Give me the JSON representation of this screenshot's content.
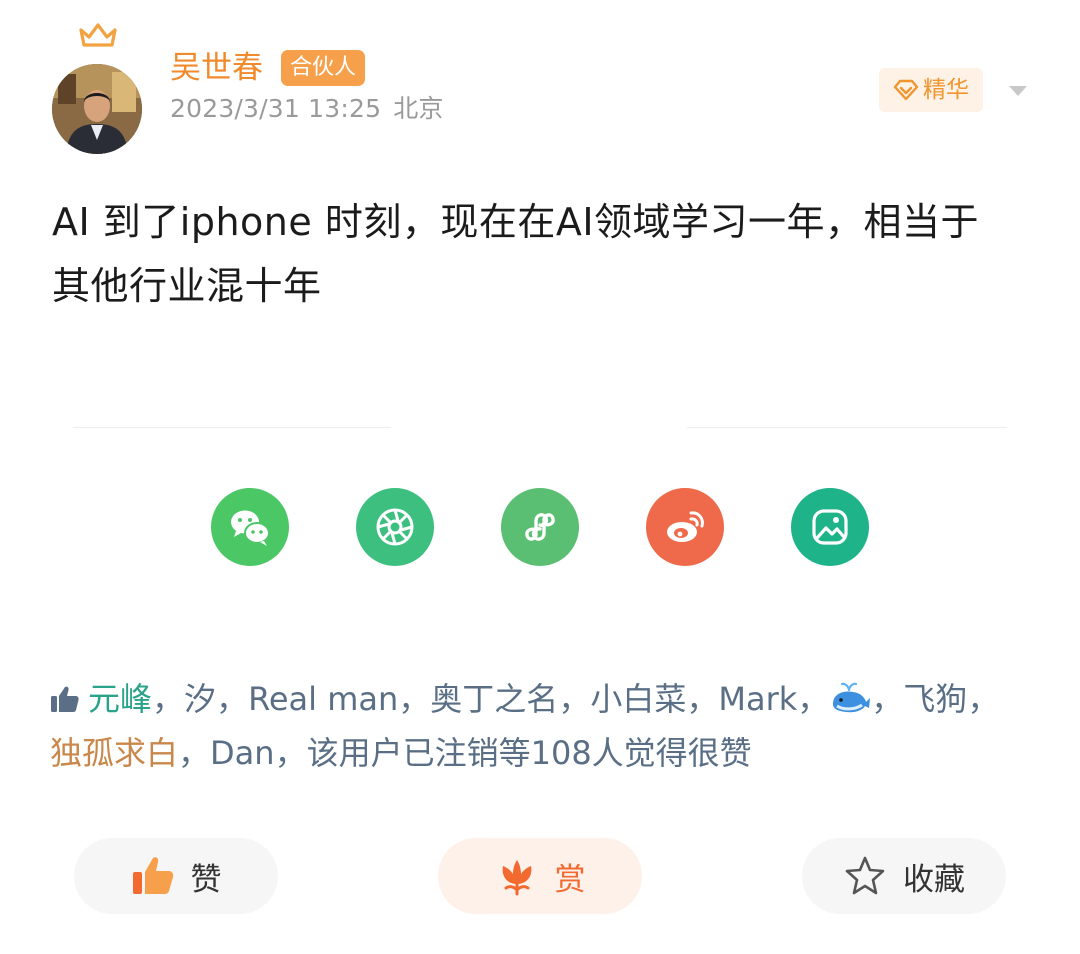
{
  "author": {
    "name": "吴世春",
    "role_badge": "合伙人",
    "date": "2023/3/31 13:25",
    "location": "北京"
  },
  "essence_badge": "精华",
  "post": {
    "text": "AI 到了iphone 时刻，现在在AI领域学习一年，相当于其他行业混十年"
  },
  "share_icons": [
    "wechat-icon",
    "moments-icon",
    "mini-program-icon",
    "weibo-icon",
    "album-icon"
  ],
  "likes": {
    "users": [
      {
        "name": "元峰",
        "style": "teal"
      },
      {
        "name": "汐",
        "style": "normal"
      },
      {
        "name": "Real man",
        "style": "normal"
      },
      {
        "name": "奥丁之名",
        "style": "normal"
      },
      {
        "name": "小白菜",
        "style": "normal"
      },
      {
        "name": "Mark",
        "style": "normal"
      },
      {
        "name": "",
        "style": "whale"
      },
      {
        "name": "飞狗",
        "style": "normal"
      },
      {
        "name": "独孤求白",
        "style": "brown"
      },
      {
        "name": "Dan",
        "style": "normal"
      },
      {
        "name": "该用户已注销",
        "style": "normal"
      }
    ],
    "separator": "，",
    "summary": "等108人觉得很赞"
  },
  "actions": {
    "like_label": "赞",
    "reward_label": "赏",
    "favorite_label": "收藏"
  },
  "colors": {
    "author": "#f08a2c",
    "badge": "#f6a04b",
    "teal": "#2aa38a",
    "weibo": "#ee6a4b",
    "wechat": "#4cc765"
  }
}
